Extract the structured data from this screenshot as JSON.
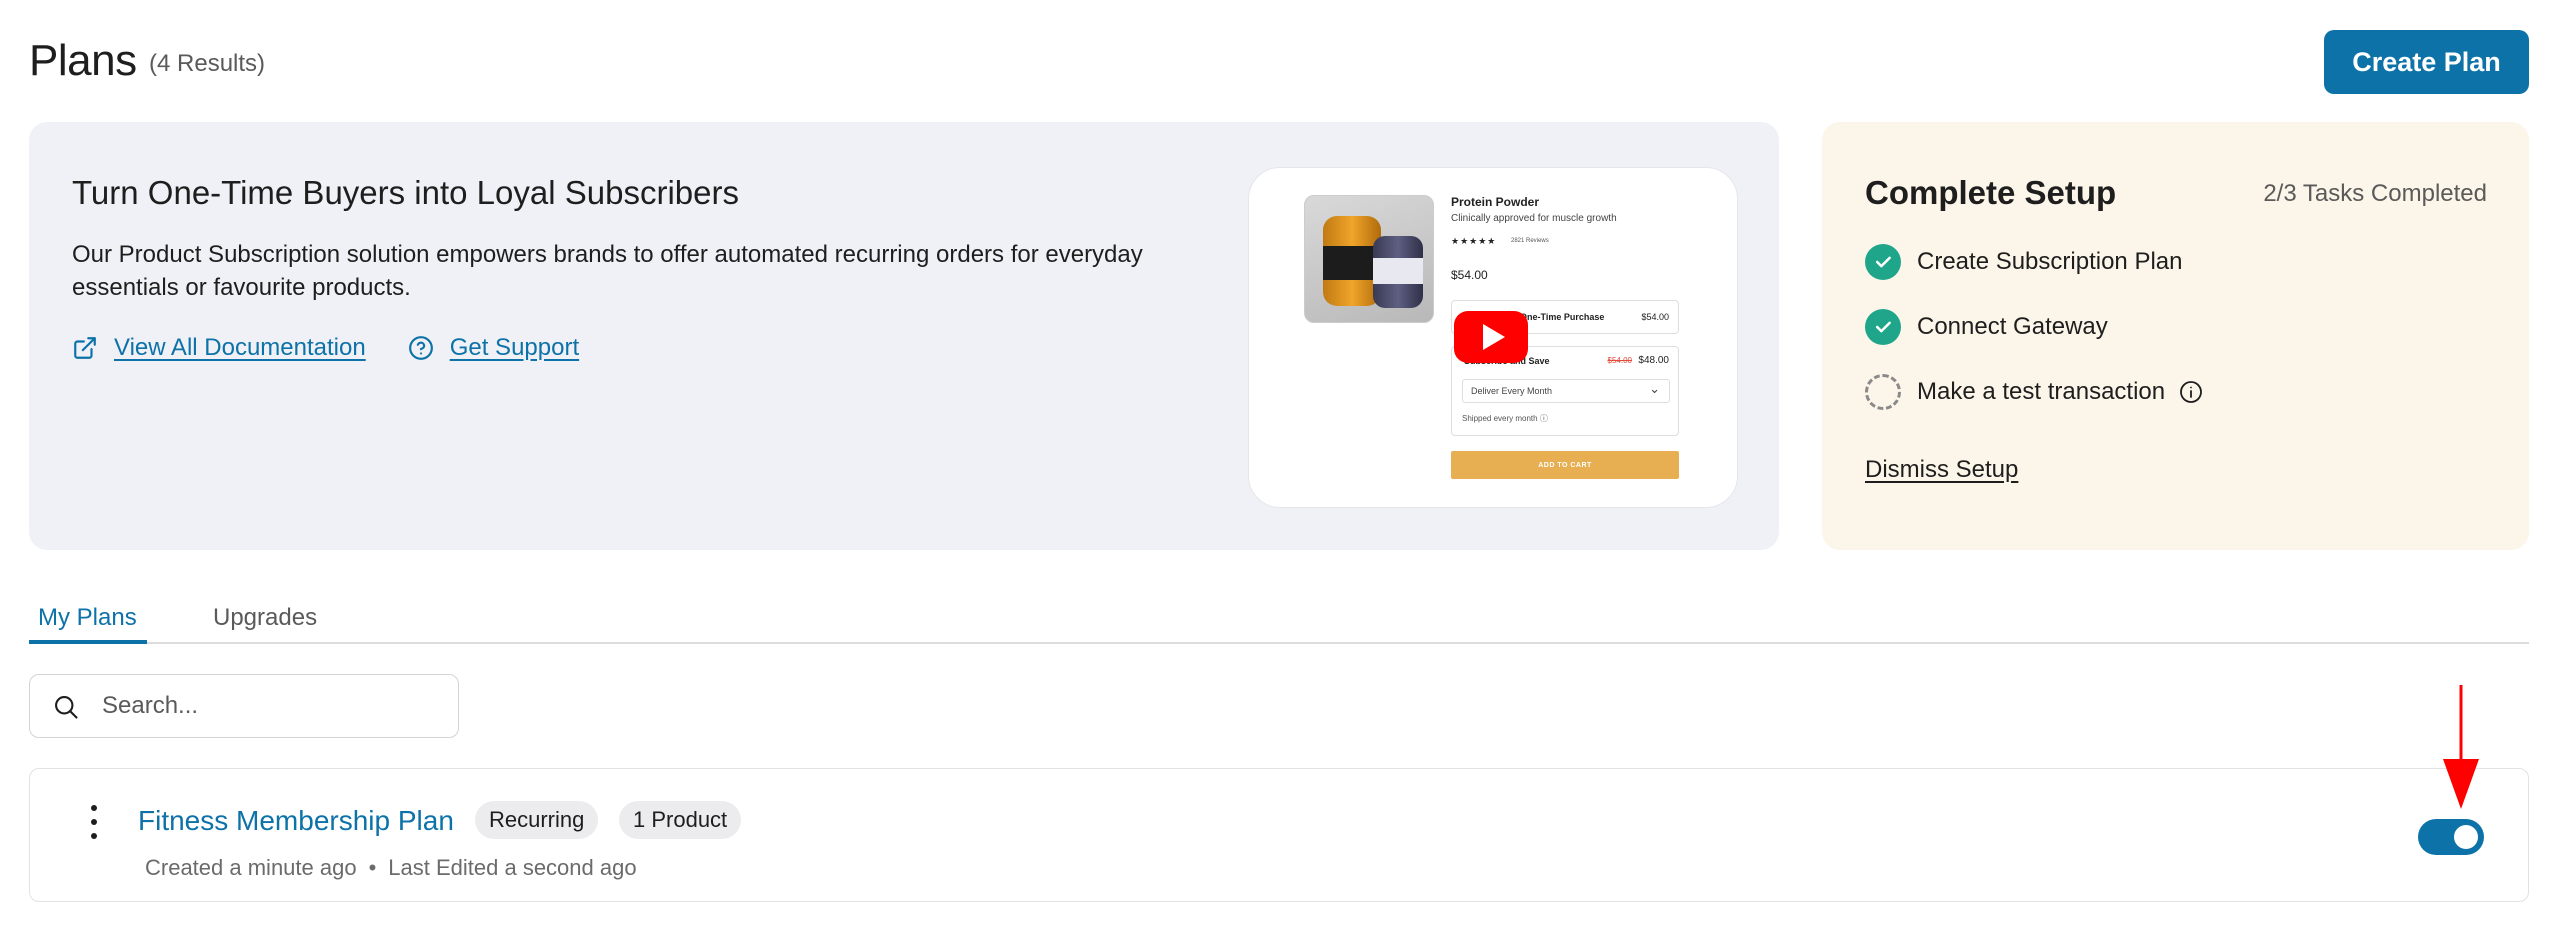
{
  "header": {
    "title": "Plans",
    "results": "(4 Results)",
    "create_label": "Create Plan"
  },
  "promo": {
    "title": "Turn One-Time Buyers into Loyal Subscribers",
    "text": "Our Product Subscription solution empowers brands to offer automated recurring orders for everyday essentials or favourite products.",
    "docs_label": "View All Documentation",
    "support_label": "Get Support",
    "video": {
      "product_title": "Protein Powder",
      "product_sub": "Clinically approved for muscle growth",
      "stars": "★★★★★",
      "reviews": "2821 Reviews",
      "price": "$54.00",
      "one_time_label": "One-Time Purchase",
      "one_time_price": "$54.00",
      "subscribe_label": "Subscribe and Save",
      "subscribe_old_price": "$54.00",
      "subscribe_price": "$48.00",
      "frequency": "Deliver Every Month",
      "shipping_note": "Shipped every month ⓘ",
      "cart_label": "ADD TO CART"
    }
  },
  "setup": {
    "title": "Complete Setup",
    "progress": "2/3 Tasks Completed",
    "tasks": [
      {
        "label": "Create Subscription Plan",
        "done": true
      },
      {
        "label": "Connect Gateway",
        "done": true
      },
      {
        "label": "Make a test transaction",
        "done": false
      }
    ],
    "dismiss_label": "Dismiss Setup"
  },
  "tabs": [
    {
      "label": "My Plans",
      "active": true
    },
    {
      "label": "Upgrades",
      "active": false
    }
  ],
  "search": {
    "placeholder": "Search..."
  },
  "plans": [
    {
      "name": "Fitness Membership Plan",
      "badges": [
        "Recurring",
        "1 Product"
      ],
      "created": "Created a minute ago",
      "edited": "Last Edited a second ago",
      "enabled": true
    }
  ],
  "colors": {
    "primary": "#0d72a8",
    "success": "#1fa68a",
    "annotation": "#ff0000",
    "promo_bg": "#f0f1f6",
    "setup_bg": "#fcf5e9"
  }
}
